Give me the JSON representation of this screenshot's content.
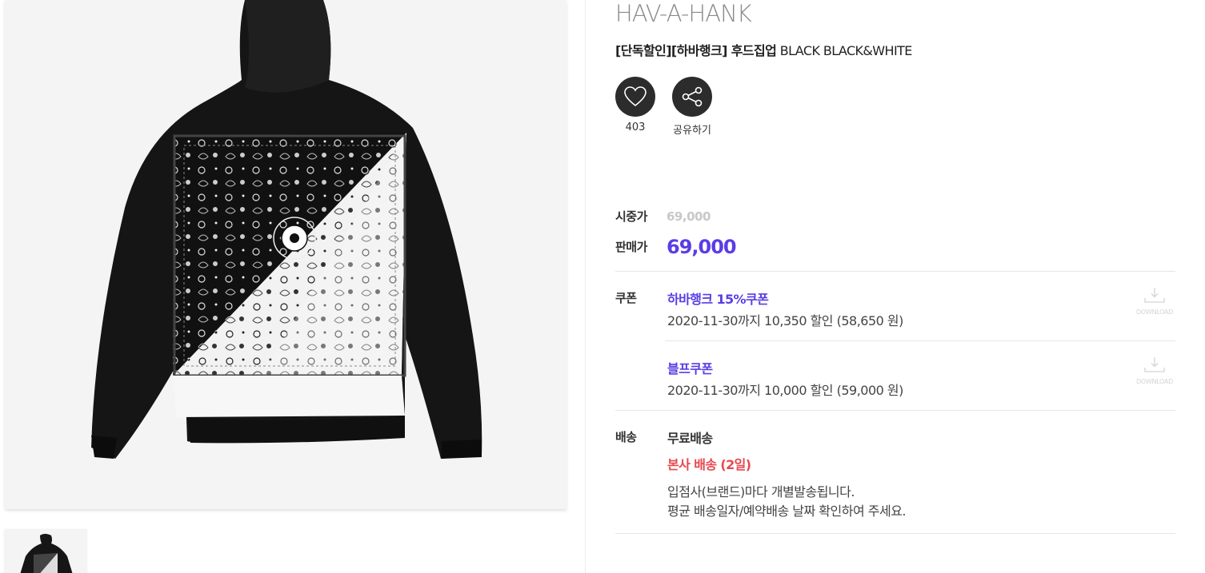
{
  "product": {
    "brand": "HAV-A-HANK",
    "name_prefix": "[단독할인][하바행크] 후드집업",
    "name_suffix": " BLACK BLACK&WHITE"
  },
  "actions": {
    "like_count": "403",
    "share_label": "공유하기"
  },
  "price": {
    "original_label": "시중가",
    "original_value": "69,000",
    "sale_label": "판매가",
    "sale_value": "69,000"
  },
  "coupons": {
    "label": "쿠폰",
    "download_label": "DOWNLOAD",
    "items": [
      {
        "name": "하바행크 15%쿠폰",
        "desc": "2020-11-30까지 10,350 할인 (58,650 원)"
      },
      {
        "name": "블프쿠폰",
        "desc": "2020-11-30까지 10,000 할인 (59,000 원)"
      }
    ]
  },
  "shipping": {
    "label": "배송",
    "type": "무료배송",
    "method": "본사 배송 (2일)",
    "note_line1": "입점사(브랜드)마다 개별발송됩니다.",
    "note_line2": "평균 배송일자/예약배송 날짜 확인하여 주세요."
  },
  "colors": {
    "accent": "#5a3de6",
    "shipping_red": "#e8474f",
    "icon_bg": "#2c2c2c"
  }
}
